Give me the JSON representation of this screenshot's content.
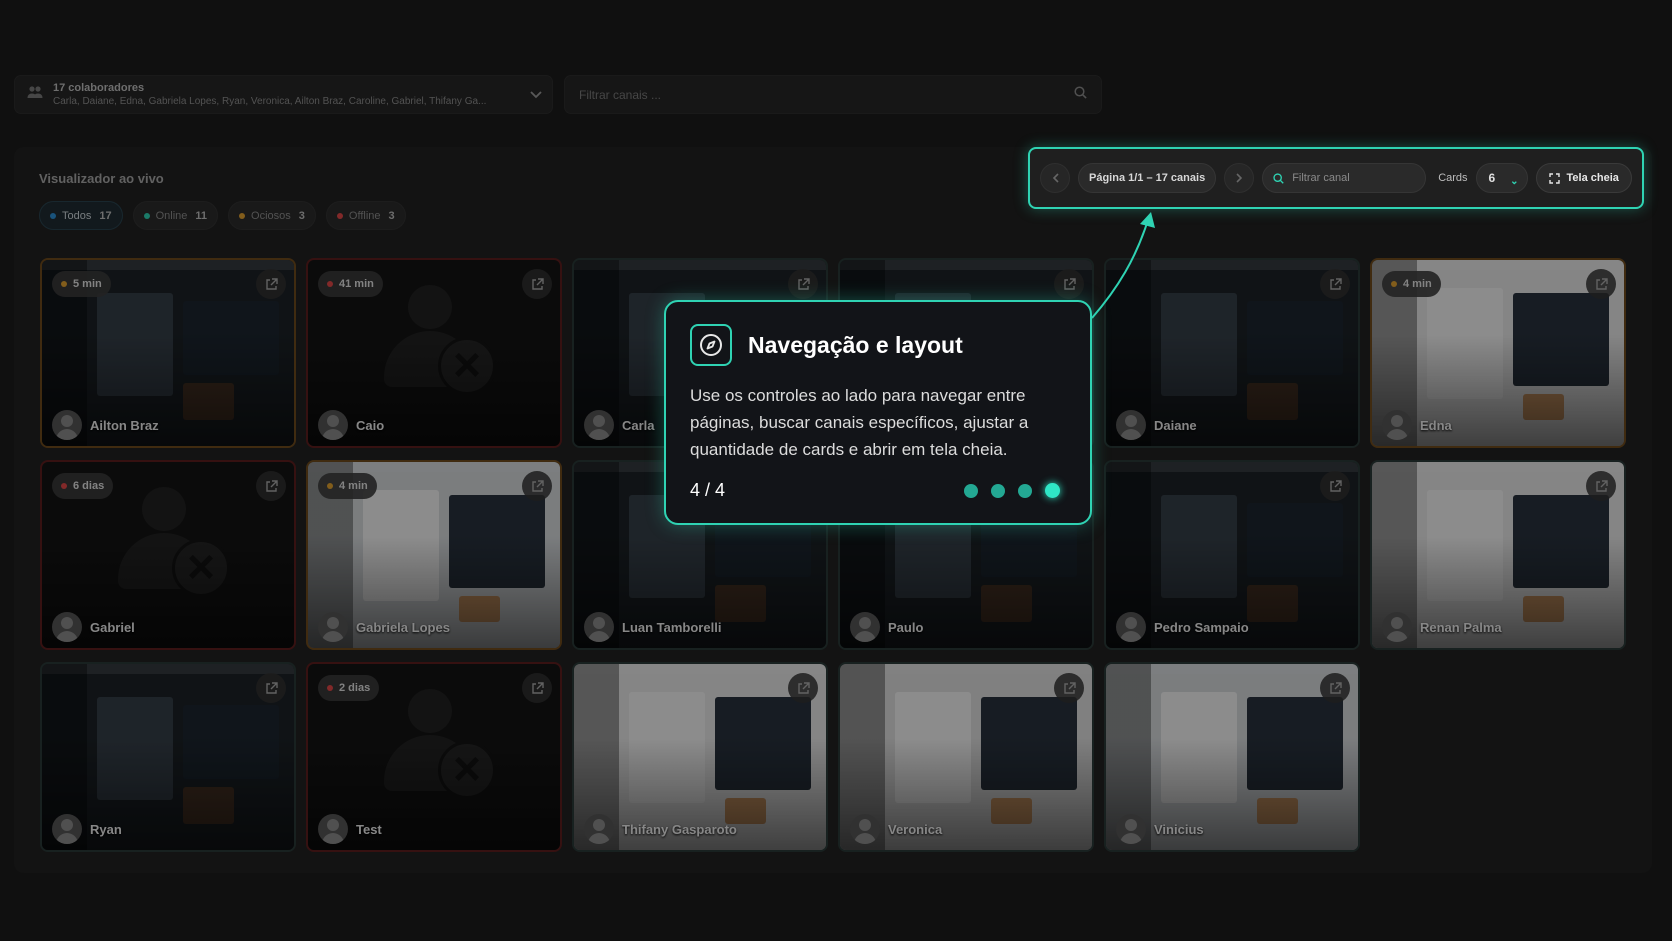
{
  "collaborators": {
    "title": "17 colaboradores",
    "names": "Carla, Daiane, Edna, Gabriela Lopes, Ryan, Veronica, Ailton Braz, Caroline, Gabriel, Thifany Ga..."
  },
  "search": {
    "placeholder": "Filtrar canais ..."
  },
  "panel": {
    "title": "Visualizador ao vivo"
  },
  "filters": [
    {
      "label": "Todos",
      "count": "17",
      "color": "#2b8fd6"
    },
    {
      "label": "Online",
      "count": "11",
      "color": "#2fd3b3"
    },
    {
      "label": "Ociosos",
      "count": "3",
      "color": "#e0a030"
    },
    {
      "label": "Offline",
      "count": "3",
      "color": "#e04848"
    }
  ],
  "controls": {
    "page": "Página 1/1 – 17 canais",
    "filter_placeholder": "Filtrar canal",
    "cards_label": "Cards",
    "cards_value": "6",
    "fullscreen": "Tela cheia"
  },
  "cards": [
    {
      "name": "Ailton Braz",
      "status": "idle",
      "badge": "5 min",
      "theme": "dark"
    },
    {
      "name": "Caio",
      "status": "offline",
      "badge": "41 min",
      "theme": "none"
    },
    {
      "name": "Carla",
      "status": "online",
      "badge": "",
      "theme": "dark"
    },
    {
      "name": "",
      "status": "online",
      "badge": "",
      "theme": "dark"
    },
    {
      "name": "Daiane",
      "status": "online",
      "badge": "",
      "theme": "dark"
    },
    {
      "name": "Edna",
      "status": "idle",
      "badge": "4 min",
      "theme": "light"
    },
    {
      "name": "Gabriel",
      "status": "offline",
      "badge": "6 dias",
      "theme": "none"
    },
    {
      "name": "Gabriela Lopes",
      "status": "idle",
      "badge": "4 min",
      "theme": "light"
    },
    {
      "name": "Luan Tamborelli",
      "status": "online",
      "badge": "",
      "theme": "dark"
    },
    {
      "name": "Paulo",
      "status": "online",
      "badge": "",
      "theme": "dark"
    },
    {
      "name": "Pedro Sampaio",
      "status": "online",
      "badge": "",
      "theme": "dark"
    },
    {
      "name": "Renan Palma",
      "status": "online",
      "badge": "",
      "theme": "light"
    },
    {
      "name": "Ryan",
      "status": "online",
      "badge": "",
      "theme": "dark"
    },
    {
      "name": "Test",
      "status": "offline",
      "badge": "2 dias",
      "theme": "none"
    },
    {
      "name": "Thifany Gasparoto",
      "status": "online",
      "badge": "",
      "theme": "light"
    },
    {
      "name": "Veronica",
      "status": "online",
      "badge": "",
      "theme": "light"
    },
    {
      "name": "Vinicius",
      "status": "online",
      "badge": "",
      "theme": "light"
    }
  ],
  "tooltip": {
    "title": "Navegação e layout",
    "body": "Use os controles ao lado para navegar entre páginas, buscar canais específicos, ajustar a quantidade de cards e abrir em tela cheia.",
    "step": "4 / 4",
    "total_steps": 4,
    "current_step": 4
  },
  "colors": {
    "accent": "#2fd3b3",
    "idle": "#e0a030",
    "offline": "#e04848"
  }
}
